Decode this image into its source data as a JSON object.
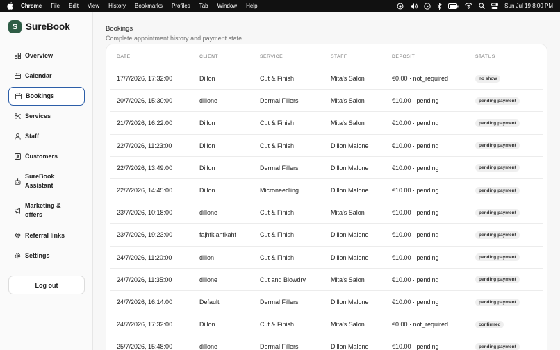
{
  "menubar": {
    "app": "Chrome",
    "items": [
      "File",
      "Edit",
      "View",
      "History",
      "Bookmarks",
      "Profiles",
      "Tab",
      "Window",
      "Help"
    ],
    "clock": "Sun Jul 19  8:00 PM"
  },
  "brand": {
    "logo_letter": "S",
    "name": "SureBook"
  },
  "sidebar": {
    "items": [
      {
        "label": "Overview",
        "icon": "grid-icon",
        "active": false
      },
      {
        "label": "Calendar",
        "icon": "calendar-icon",
        "active": false
      },
      {
        "label": "Bookings",
        "icon": "calendar-icon",
        "active": true
      },
      {
        "label": "Services",
        "icon": "scissors-icon",
        "active": false
      },
      {
        "label": "Staff",
        "icon": "person-icon",
        "active": false
      },
      {
        "label": "Customers",
        "icon": "contacts-icon",
        "active": false
      },
      {
        "label": "SureBook Assistant",
        "icon": "robot-icon",
        "active": false
      },
      {
        "label": "Marketing & offers",
        "icon": "megaphone-icon",
        "active": false
      },
      {
        "label": "Referral links",
        "icon": "handshake-icon",
        "active": false
      },
      {
        "label": "Settings",
        "icon": "gear-icon",
        "active": false
      }
    ],
    "logout_label": "Log out"
  },
  "page": {
    "title": "Bookings",
    "subtitle": "Complete appointment history and payment state."
  },
  "table": {
    "columns": [
      "DATE",
      "CLIENT",
      "SERVICE",
      "STAFF",
      "DEPOSIT",
      "STATUS"
    ],
    "rows": [
      {
        "date": "17/7/2026, 17:32:00",
        "client": "Dillon",
        "service": "Cut & Finish",
        "staff": "Mita's Salon",
        "deposit": "€0.00 · not_required",
        "status": "no show"
      },
      {
        "date": "20/7/2026, 15:30:00",
        "client": "dillone",
        "service": "Dermal Fillers",
        "staff": "Mita's Salon",
        "deposit": "€10.00 · pending",
        "status": "pending payment"
      },
      {
        "date": "21/7/2026, 16:22:00",
        "client": "Dillon",
        "service": "Cut & Finish",
        "staff": "Mita's Salon",
        "deposit": "€10.00 · pending",
        "status": "pending payment"
      },
      {
        "date": "22/7/2026, 11:23:00",
        "client": "Dillon",
        "service": "Cut & Finish",
        "staff": "Dillon Malone",
        "deposit": "€10.00 · pending",
        "status": "pending payment"
      },
      {
        "date": "22/7/2026, 13:49:00",
        "client": "Dillon",
        "service": "Dermal Fillers",
        "staff": "Dillon Malone",
        "deposit": "€10.00 · pending",
        "status": "pending payment"
      },
      {
        "date": "22/7/2026, 14:45:00",
        "client": "Dillon",
        "service": "Microneedling",
        "staff": "Dillon Malone",
        "deposit": "€10.00 · pending",
        "status": "pending payment"
      },
      {
        "date": "23/7/2026, 10:18:00",
        "client": "dillone",
        "service": "Cut & Finish",
        "staff": "Mita's Salon",
        "deposit": "€10.00 · pending",
        "status": "pending payment"
      },
      {
        "date": "23/7/2026, 19:23:00",
        "client": "fajhfkjahfkahf",
        "service": "Cut & Finish",
        "staff": "Dillon Malone",
        "deposit": "€10.00 · pending",
        "status": "pending payment"
      },
      {
        "date": "24/7/2026, 11:20:00",
        "client": "dillon",
        "service": "Cut & Finish",
        "staff": "Dillon Malone",
        "deposit": "€10.00 · pending",
        "status": "pending payment"
      },
      {
        "date": "24/7/2026, 11:35:00",
        "client": "dillone",
        "service": "Cut and Blowdry",
        "staff": "Mita's Salon",
        "deposit": "€10.00 · pending",
        "status": "pending payment"
      },
      {
        "date": "24/7/2026, 16:14:00",
        "client": "Default",
        "service": "Dermal Fillers",
        "staff": "Dillon Malone",
        "deposit": "€10.00 · pending",
        "status": "pending payment"
      },
      {
        "date": "24/7/2026, 17:32:00",
        "client": "Dillon",
        "service": "Cut & Finish",
        "staff": "Mita's Salon",
        "deposit": "€0.00 · not_required",
        "status": "confirmed"
      },
      {
        "date": "25/7/2026, 15:48:00",
        "client": "dillone",
        "service": "Dermal Fillers",
        "staff": "Dillon Malone",
        "deposit": "€10.00 · pending",
        "status": "pending payment"
      }
    ]
  }
}
